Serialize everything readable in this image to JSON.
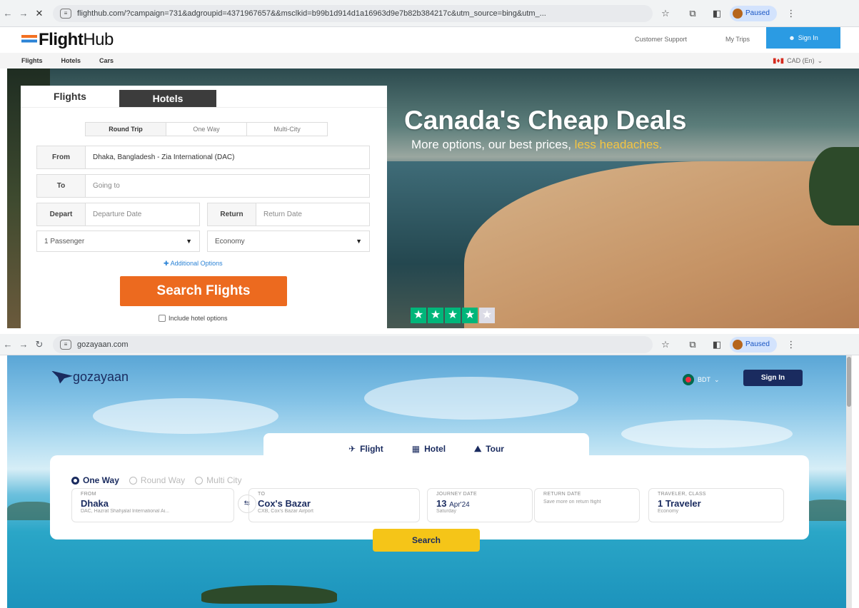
{
  "browser1": {
    "url": "flighthub.com/?campaign=731&adgroupid=4371967657&&msclkid=b99b1d914d1a16963d9e7b82b384217c&utm_source=bing&utm_...",
    "profile": "Paused"
  },
  "flighthub": {
    "logo_bold": "Flight",
    "logo_light": "Hub",
    "customer_support": "Customer Support",
    "my_trips": "My Trips",
    "sign_in": "Sign In",
    "nav": [
      "Flights",
      "Hotels",
      "Cars"
    ],
    "currency": "CAD (En)",
    "tabs": [
      "Flights",
      "Hotels"
    ],
    "trip_types": [
      "Round Trip",
      "One Way",
      "Multi-City"
    ],
    "from_label": "From",
    "from_value": "Dhaka, Bangladesh - Zia International (DAC)",
    "to_label": "To",
    "to_placeholder": "Going to",
    "depart_label": "Depart",
    "depart_placeholder": "Departure Date",
    "return_label": "Return",
    "return_placeholder": "Return Date",
    "passengers": "1 Passenger",
    "cabin": "Economy",
    "additional_options": "Additional Options",
    "search_button": "Search Flights",
    "include_hotel": "Include hotel options",
    "hero_title": "Canada's Cheap Deals",
    "hero_sub_a": "More options, our best prices, ",
    "hero_sub_b": "less headaches.",
    "rating_stars": 4
  },
  "browser2": {
    "url": "gozayaan.com",
    "profile": "Paused"
  },
  "gozayaan": {
    "logo": "gozayaan",
    "currency": "BDT",
    "sign_in": "Sign In",
    "tabs": [
      "Flight",
      "Hotel",
      "Tour"
    ],
    "trip_types": [
      "One Way",
      "Round Way",
      "Multi City"
    ],
    "from_label": "FROM",
    "from_city": "Dhaka",
    "from_airport": "DAC, Hazrat Shahjalal International Ai...",
    "to_label": "TO",
    "to_city": "Cox's Bazar",
    "to_airport": "CXB, Cox's Bazar Airport",
    "journey_label": "JOURNEY DATE",
    "journey_day": "13",
    "journey_month": "Apr'24",
    "journey_weekday": "Saturday",
    "return_label": "RETURN DATE",
    "return_hint": "Save more on return flight",
    "traveler_label": "TRAVELER, CLASS",
    "traveler_value": "1 Traveler",
    "traveler_class": "Economy",
    "search_button": "Search"
  }
}
